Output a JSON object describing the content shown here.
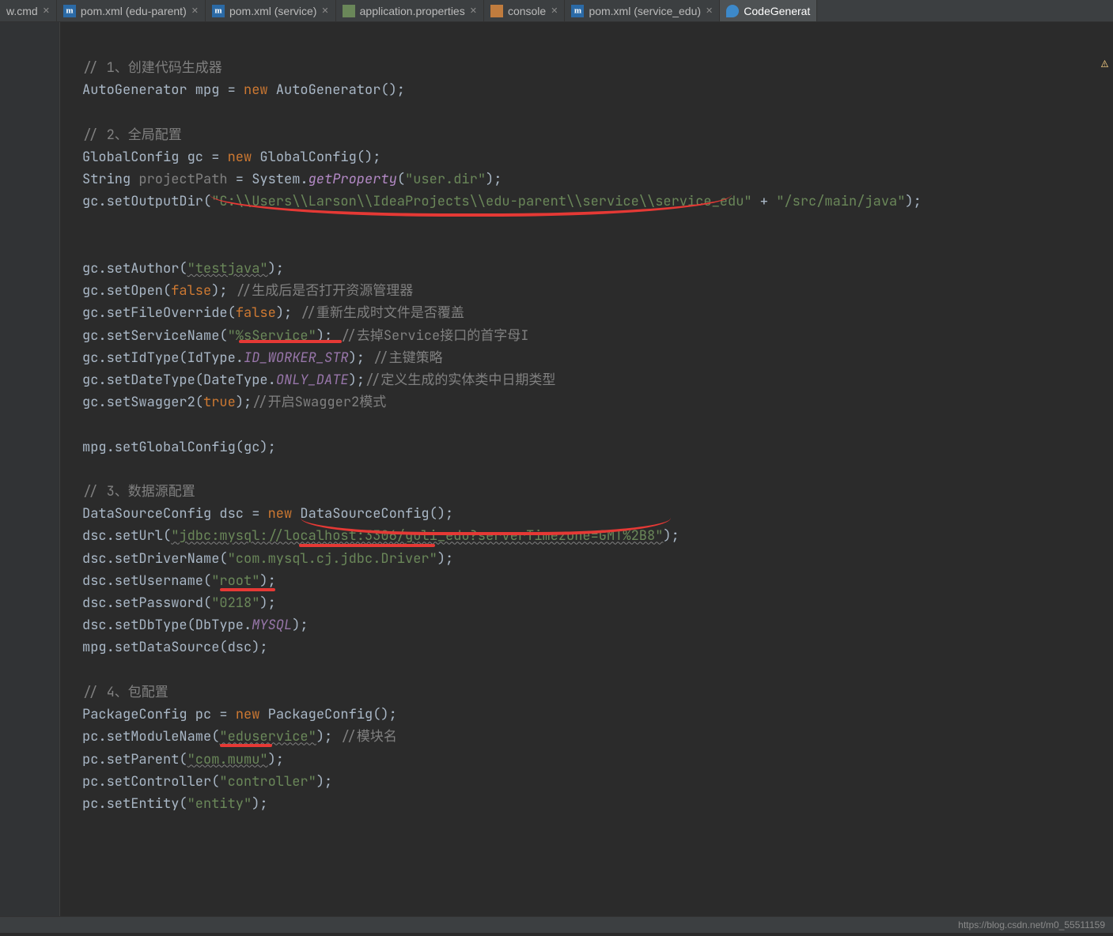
{
  "tabs": [
    {
      "icon": "cmd",
      "label": "w.cmd"
    },
    {
      "icon": "maven",
      "label": "pom.xml (edu-parent)"
    },
    {
      "icon": "maven",
      "label": "pom.xml (service)"
    },
    {
      "icon": "prop",
      "label": "application.properties"
    },
    {
      "icon": "html",
      "label": "console"
    },
    {
      "icon": "maven",
      "label": "pom.xml (service_edu)"
    },
    {
      "icon": "java",
      "label": "CodeGenerat"
    }
  ],
  "code": {
    "c1": "// 1、创建代码生成器",
    "l2a": "AutoGenerator mpg = ",
    "l2b": "new",
    "l2c": " AutoGenerator();",
    "c2": "// 2、全局配置",
    "l4a": "GlobalConfig gc = ",
    "l4b": "new",
    "l4c": " GlobalConfig();",
    "l5a": "String ",
    "l5v": "projectPath",
    "l5b": " = System.",
    "l5m": "getProperty",
    "l5c": "(",
    "l5s": "\"user.dir\"",
    "l5d": ");",
    "l6a": "gc.setOutputDir(",
    "l6s": "\"C:\\\\Users\\\\Larson\\\\IdeaProjects\\\\edu-parent\\\\service\\\\service_edu\"",
    "l6b": " + ",
    "l6s2": "\"/src/main/java\"",
    "l6c": ");",
    "l7a": "gc.setAuthor(",
    "l7s": "\"testjava\"",
    "l7b": ");",
    "l8a": "gc.setOpen(",
    "l8k": "false",
    "l8b": "); ",
    "l8c": "//生成后是否打开资源管理器",
    "l9a": "gc.setFileOverride(",
    "l9k": "false",
    "l9b": "); ",
    "l9c": "//重新生成时文件是否覆盖",
    "l10a": "gc.setServiceName(",
    "l10s": "\"%sService\"",
    "l10b": "); ",
    "l10c": "//去掉Service接口的首字母I",
    "l11a": "gc.setIdType(IdType.",
    "l11f": "ID_WORKER_STR",
    "l11b": "); ",
    "l11c": "//主键策略",
    "l12a": "gc.setDateType(DateType.",
    "l12f": "ONLY_DATE",
    "l12b": ");",
    "l12c": "//定义生成的实体类中日期类型",
    "l13a": "gc.setSwagger2(",
    "l13k": "true",
    "l13b": ");",
    "l13c": "//开启Swagger2模式",
    "l14": "mpg.setGlobalConfig(gc);",
    "c3": "// 3、数据源配置",
    "l16a": "DataSourceConfig dsc = ",
    "l16b": "new",
    "l16c": " DataSourceConfig();",
    "l17a": "dsc.setUrl(",
    "l17s": "\"jdbc:mysql://localhost:3306/guli_edu?serverTimezone=GMT%2B8\"",
    "l17b": ");",
    "l18a": "dsc.setDriverName(",
    "l18s": "\"com.mysql.cj.jdbc.Driver\"",
    "l18b": ");",
    "l19a": "dsc.setUsername(",
    "l19s": "\"root\"",
    "l19b": ");",
    "l20a": "dsc.setPassword(",
    "l20s": "\"0218\"",
    "l20b": ");",
    "l21a": "dsc.setDbType(DbType.",
    "l21f": "MYSQL",
    "l21b": ");",
    "l22": "mpg.setDataSource(dsc);",
    "c4": "// 4、包配置",
    "l24a": "PackageConfig pc = ",
    "l24b": "new",
    "l24c": " PackageConfig();",
    "l25a": "pc.setModuleName(",
    "l25s": "\"eduservice\"",
    "l25b": "); ",
    "l25c": "//模块名",
    "l26a": "pc.setParent(",
    "l26s": "\"com.mumu\"",
    "l26b": ");",
    "l27a": "pc.setController(",
    "l27s": "\"controller\"",
    "l27b": ");",
    "l28a": "pc.setEntity(",
    "l28s": "\"entity\"",
    "l28b": ");"
  },
  "status_url": "https://blog.csdn.net/m0_55511159",
  "warn_glyph": "⚠"
}
